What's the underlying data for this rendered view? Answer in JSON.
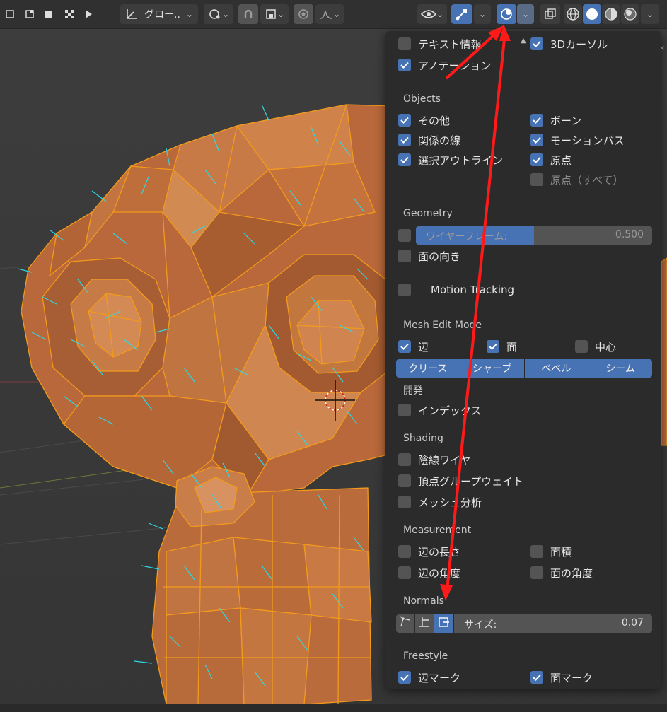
{
  "header": {
    "orientation_label": "グロー..",
    "icons": [
      "select-box-icon",
      "select-extend-icon",
      "select-subtract-icon",
      "select-intersect-icon",
      "checker-icon",
      "play-icon",
      "transform-orientation-icon",
      "pivot-icon",
      "snap-icon",
      "snap-target-icon",
      "proportional-edit-icon",
      "falloff-icon",
      "visibility-icon",
      "gizmo-icon",
      "overlay-icon",
      "xray-icon",
      "shading-wireframe-icon",
      "shading-solid-icon",
      "shading-material-icon",
      "shading-rendered-icon"
    ]
  },
  "overlays": {
    "top": {
      "text_info": "テキスト情報",
      "annotation": "アノテーション",
      "cursor_3d": "3Dカーソル"
    },
    "objects": {
      "title": "Objects",
      "other": "その他",
      "relationship_lines": "関係の線",
      "outline_selected": "選択アウトライン",
      "bones": "ボーン",
      "motion_paths": "モーションパス",
      "origins": "原点",
      "origins_all": "原点（すべて）"
    },
    "geometry": {
      "title": "Geometry",
      "wireframe_label": "ワイヤーフレーム:",
      "wireframe_value": "0.500",
      "wireframe_fraction": 0.5,
      "face_orientation": "面の向き",
      "motion_tracking": "Motion Tracking"
    },
    "mesh_edit": {
      "title": "Mesh Edit Mode",
      "edges": "辺",
      "faces": "面",
      "center": "中心",
      "buttons": [
        "クリース",
        "シャープ",
        "ベベル",
        "シーム"
      ]
    },
    "developer": {
      "title": "開発",
      "indices": "インデックス"
    },
    "shading": {
      "title": "Shading",
      "hidden_wire": "陰線ワイヤ",
      "vertex_group_weights": "頂点グループウェイト",
      "mesh_analysis": "メッシュ分析"
    },
    "measurement": {
      "title": "Measurement",
      "edge_length": "辺の長さ",
      "edge_angle": "辺の角度",
      "face_area": "面積",
      "face_angle": "面の角度"
    },
    "normals": {
      "title": "Normals",
      "size_label": "サイズ:",
      "size_value": "0.07"
    },
    "freestyle": {
      "title": "Freestyle",
      "edge_marks": "辺マーク",
      "face_marks": "面マーク"
    }
  },
  "colors": {
    "accent": "#4772b3",
    "mesh": "#c8743f",
    "wire": "#f39a1c",
    "normals": "#2fd8e6",
    "arrow": "#ff0000"
  }
}
